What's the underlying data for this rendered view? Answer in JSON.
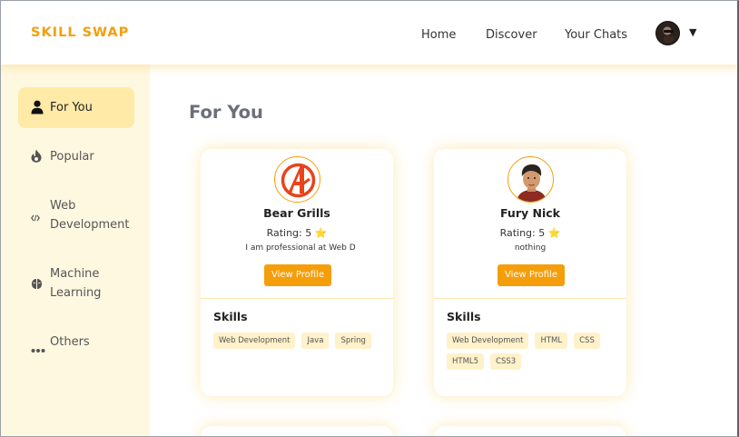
{
  "header": {
    "brand": "SKILL SWAP",
    "nav": {
      "home": "Home",
      "discover": "Discover",
      "chats": "Your Chats"
    },
    "caret": "▼"
  },
  "sidebar": {
    "items": [
      {
        "label": "For You",
        "icon": "user-icon",
        "active": true
      },
      {
        "label": "Popular",
        "icon": "fire-icon",
        "active": false
      },
      {
        "label": "Web Development",
        "icon": "code-icon",
        "active": false
      },
      {
        "label": "Machine Learning",
        "icon": "brain-icon",
        "active": false
      },
      {
        "label": "Others",
        "icon": "ellipsis-icon",
        "active": false
      }
    ]
  },
  "main": {
    "title": "For You",
    "cards": [
      {
        "name": "Bear Grills",
        "rating": "Rating: 5 ⭐",
        "bio": "I am professional at Web D",
        "button": "View Profile",
        "skills_title": "Skills",
        "tags": [
          "Web Development",
          "Java",
          "Spring"
        ],
        "avatar": "avengers-logo-icon"
      },
      {
        "name": "Fury Nick",
        "rating": "Rating: 5 ⭐",
        "bio": "nothing",
        "button": "View Profile",
        "skills_title": "Skills",
        "tags": [
          "Web Development",
          "HTML",
          "CSS",
          "HTML5",
          "CSS3"
        ],
        "avatar": "cartoon-man-avatar"
      }
    ]
  },
  "colors": {
    "accent": "#f59e0b",
    "sidebar_bg": "#fff8e1",
    "active_bg": "#ffeaa7",
    "tag_bg": "#fff1c9"
  }
}
